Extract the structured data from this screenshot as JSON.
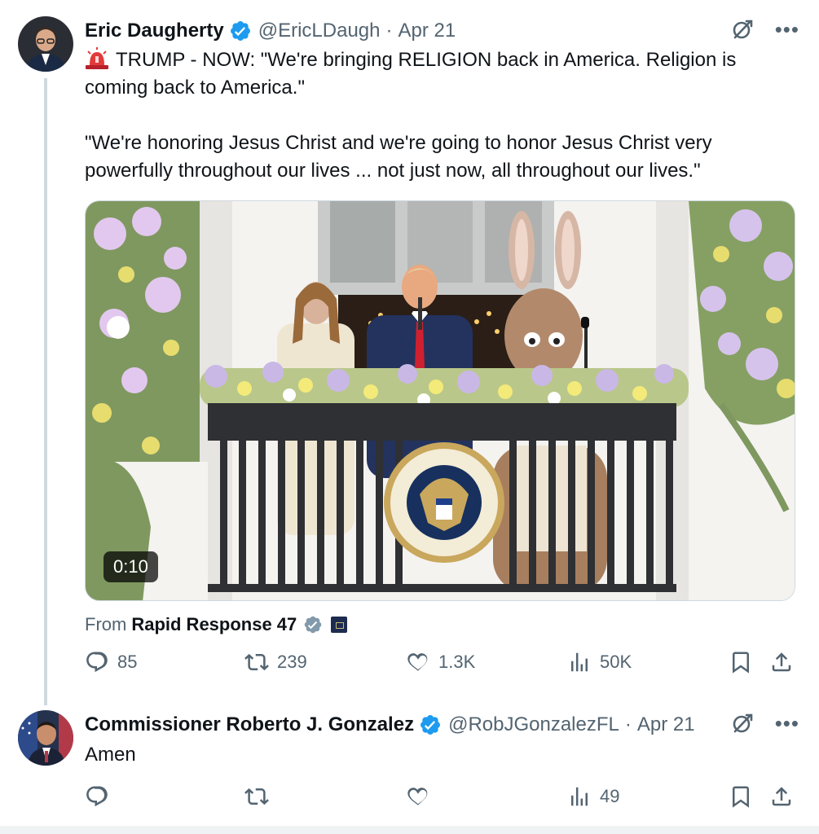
{
  "tweets": [
    {
      "author_name": "Eric Daugherty",
      "handle": "@EricLDaugh",
      "separator": "·",
      "date": "Apr 21",
      "text_line1": "TRUMP - NOW: \"We're bringing RELIGION back in America. Religion is coming back to America.\"",
      "text_line2": "\"We're honoring Jesus Christ and we're going to honor Jesus Christ very powerfully throughout our lives ... not just now, all throughout our lives.\"",
      "video_duration": "0:10",
      "source_prefix": "From",
      "source_name": "Rapid Response 47",
      "stats": {
        "replies": "85",
        "reposts": "239",
        "likes": "1.3K",
        "views": "50K"
      }
    },
    {
      "author_name": "Commissioner Roberto J. Gonzalez",
      "handle": "@RobJGonzalezFL",
      "separator": "·",
      "date": "Apr 21",
      "text": "Amen",
      "stats": {
        "replies": "",
        "reposts": "",
        "likes": "",
        "views": "49"
      }
    }
  ],
  "colors": {
    "verified": "#1d9bf0",
    "muted": "#536471",
    "text": "#0f1419",
    "border": "#cfd9de"
  },
  "icons": [
    "siren-emoji-icon",
    "verified-badge-icon",
    "grok-icon",
    "more-icon",
    "reply-icon",
    "repost-icon",
    "like-icon",
    "views-icon",
    "bookmark-icon",
    "share-icon"
  ]
}
